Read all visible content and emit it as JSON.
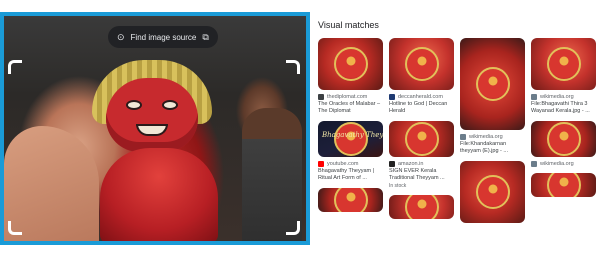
{
  "lens": {
    "find_image_source_label": "Find image source",
    "icons": {
      "lens": "google-lens-icon",
      "open": "open-in-new-icon"
    },
    "selection_border_color": "#1a9bd7"
  },
  "matches": {
    "title": "Visual matches",
    "columns": [
      [
        {
          "thumb": "red1",
          "h": 52,
          "site": "thediplomat.com",
          "title": "The Oracles of Malabar – The Diplomat",
          "favicon": "#3c4043"
        },
        {
          "thumb": "dark",
          "h": 36,
          "caption": "Bhagavathy Theyyam",
          "site": "youtube.com",
          "title": "Bhagavathy Theyyam | Ritual Art Form of ...",
          "favicon": "#ff0000"
        },
        {
          "thumb": "red3",
          "h": 24,
          "site": "",
          "title": ""
        }
      ],
      [
        {
          "thumb": "red2",
          "h": 52,
          "site": "deccanherald.com",
          "title": "Hotline to God | Deccan Herald",
          "favicon": "#1f3b73"
        },
        {
          "thumb": "red1",
          "h": 36,
          "site": "amazon.in",
          "title": "SIGN EVER Kerala Traditional Theyyam ...",
          "stock": "In stock",
          "favicon": "#222222"
        },
        {
          "thumb": "red2",
          "h": 24,
          "site": "",
          "title": ""
        }
      ],
      [
        {
          "thumb": "red3",
          "h": 92,
          "site": "wikimedia.org",
          "title": "File:Khandakarnan theyyam (E).jpg - ...",
          "favicon": "#6b7d8b"
        },
        {
          "thumb": "red1",
          "h": 62,
          "site": "",
          "title": ""
        }
      ],
      [
        {
          "thumb": "red2",
          "h": 52,
          "site": "wikimedia.org",
          "title": "File:Bhagavathi Thira 3 Wayanad Kerala.jpg - ...",
          "favicon": "#6b7d8b"
        },
        {
          "thumb": "red3",
          "h": 36,
          "site": "wikimedia.org",
          "title": "",
          "favicon": "#6b7d8b"
        },
        {
          "thumb": "red1",
          "h": 24,
          "site": "",
          "title": ""
        }
      ]
    ]
  }
}
